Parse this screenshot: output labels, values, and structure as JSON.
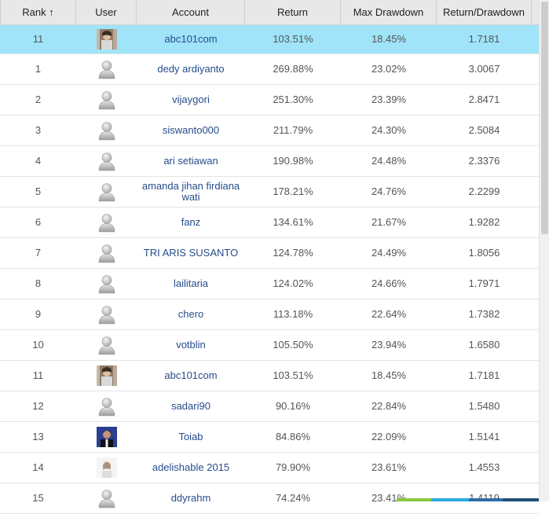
{
  "columns": [
    "Rank ↑",
    "User",
    "Account",
    "Return",
    "Max Drawdown",
    "Return/Drawdown"
  ],
  "highlighted_row": {
    "rank": "11",
    "avatar": "photo-person-icon",
    "account": "abc101com",
    "return": "103.51%",
    "max_drawdown": "18.45%",
    "ratio": "1.7181"
  },
  "rows": [
    {
      "rank": "1",
      "avatar": "default-user-icon",
      "account": "dedy ardiyanto",
      "return": "269.88%",
      "max_drawdown": "23.02%",
      "ratio": "3.0067"
    },
    {
      "rank": "2",
      "avatar": "default-user-icon",
      "account": "vijaygori",
      "return": "251.30%",
      "max_drawdown": "23.39%",
      "ratio": "2.8471"
    },
    {
      "rank": "3",
      "avatar": "default-user-icon",
      "account": "siswanto000",
      "return": "211.79%",
      "max_drawdown": "24.30%",
      "ratio": "2.5084"
    },
    {
      "rank": "4",
      "avatar": "default-user-icon",
      "account": "ari setiawan",
      "return": "190.98%",
      "max_drawdown": "24.48%",
      "ratio": "2.3376"
    },
    {
      "rank": "5",
      "avatar": "default-user-icon",
      "account": "amanda jihan firdiana wati",
      "return": "178.21%",
      "max_drawdown": "24.76%",
      "ratio": "2.2299"
    },
    {
      "rank": "6",
      "avatar": "default-user-icon",
      "account": "fanz",
      "return": "134.61%",
      "max_drawdown": "21.67%",
      "ratio": "1.9282"
    },
    {
      "rank": "7",
      "avatar": "default-user-icon",
      "account": "TRI ARIS SUSANTO",
      "return": "124.78%",
      "max_drawdown": "24.49%",
      "ratio": "1.8056"
    },
    {
      "rank": "8",
      "avatar": "default-user-icon",
      "account": "lailitaria",
      "return": "124.02%",
      "max_drawdown": "24.66%",
      "ratio": "1.7971"
    },
    {
      "rank": "9",
      "avatar": "default-user-icon",
      "account": "chero",
      "return": "113.18%",
      "max_drawdown": "22.64%",
      "ratio": "1.7382"
    },
    {
      "rank": "10",
      "avatar": "default-user-icon",
      "account": "votblin",
      "return": "105.50%",
      "max_drawdown": "23.94%",
      "ratio": "1.6580"
    },
    {
      "rank": "11",
      "avatar": "photo-person-icon",
      "account": "abc101com",
      "return": "103.51%",
      "max_drawdown": "18.45%",
      "ratio": "1.7181"
    },
    {
      "rank": "12",
      "avatar": "default-user-icon",
      "account": "sadari90",
      "return": "90.16%",
      "max_drawdown": "22.84%",
      "ratio": "1.5480"
    },
    {
      "rank": "13",
      "avatar": "photo-dark-icon",
      "account": "Toiab",
      "return": "84.86%",
      "max_drawdown": "22.09%",
      "ratio": "1.5141"
    },
    {
      "rank": "14",
      "avatar": "photo-light-icon",
      "account": "adelishable 2015",
      "return": "79.90%",
      "max_drawdown": "23.61%",
      "ratio": "1.4553"
    },
    {
      "rank": "15",
      "avatar": "default-user-icon",
      "account": "ddyrahm",
      "return": "74.24%",
      "max_drawdown": "23.41%",
      "ratio": "1.4119"
    }
  ],
  "colors": {
    "highlight": "#9fe4f9",
    "header": "#e8e8e8",
    "link": "#264d8c"
  },
  "bottom_strip_colors": [
    "#8dc63f",
    "#29abe2",
    "#2e6da4",
    "#1f4e79"
  ]
}
